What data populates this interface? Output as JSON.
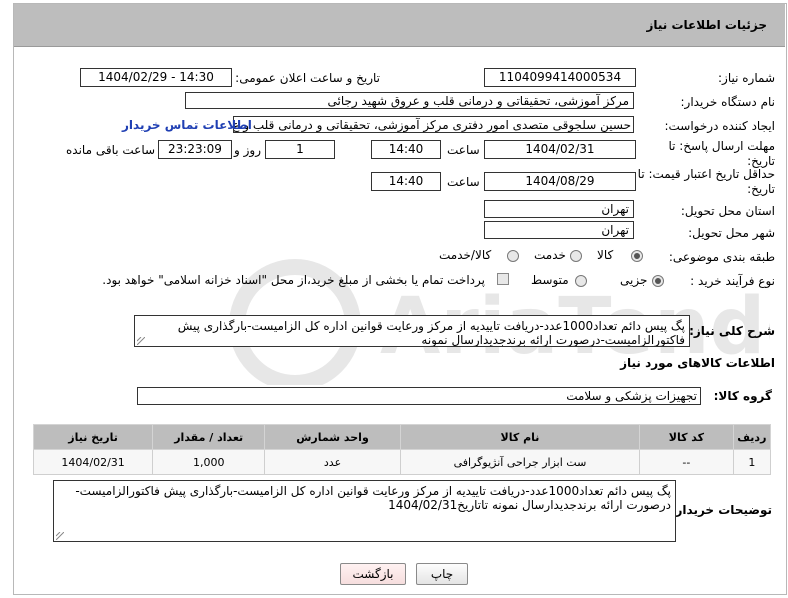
{
  "header": {
    "title": "جزئیات اطلاعات نیاز"
  },
  "fields": {
    "need_number_label": "شماره نیاز:",
    "need_number": "1104099414000534",
    "announce_label": "تاریخ و ساعت اعلان عمومی:",
    "announce_value": "1404/02/29 - 14:30",
    "buyer_org_label": "نام دستگاه خریدار:",
    "buyer_org": "مرکز آموزشی، تحقیقاتی و درمانی قلب و عروق شهید رجائی",
    "creator_label": "ایجاد کننده درخواست:",
    "creator": "حسین سلجوقی متصدی امور دفتری مرکز آموزشی، تحقیقاتی و درمانی قلب و ع",
    "contact_link": "اطلاعات تماس خریدار",
    "reply_deadline_label": "مهلت ارسال پاسخ: تا تاریخ:",
    "reply_date": "1404/02/31",
    "time_label": "ساعت",
    "reply_time": "14:40",
    "days_value": "1",
    "days_label": "روز و",
    "remaining_time": "23:23:09",
    "remaining_label": "ساعت باقی مانده",
    "min_price_label": "حداقل تاریخ اعتبار قیمت: تا تاریخ:",
    "min_price_date": "1404/08/29",
    "min_price_time": "14:40",
    "province_label": "استان محل تحویل:",
    "province": "تهران",
    "city_label": "شهر محل تحویل:",
    "city": "تهران",
    "category_label": "طبقه بندی موضوعی:",
    "category_options": [
      "کالا",
      "خدمت",
      "کالا/خدمت"
    ],
    "process_label": "نوع فرآیند خرید :",
    "process_options": [
      "جزیی",
      "متوسط"
    ],
    "payment_note": "پرداخت تمام یا بخشی از مبلغ خرید،از محل \"اسناد خزانه اسلامی\" خواهد بود."
  },
  "description": {
    "label": "شرح کلی نیاز:",
    "text": "پگ پیس دائم تعداد1000عدد-دریافت تاییدیه از مرکز ورعایت قوانین اداره کل الزامیست-بارگذاری پیش فاکتورالزامیست-درصورت ارائه برندجدیدارسال نمونه"
  },
  "goods_section": {
    "title": "اطلاعات کالاهای مورد نیاز",
    "group_label": "گروه کالا:",
    "group_value": "تجهیزات پزشکی و سلامت"
  },
  "table": {
    "headers": [
      "ردیف",
      "کد کالا",
      "نام کالا",
      "واحد شمارش",
      "تعداد / مقدار",
      "تاریخ نیاز"
    ],
    "rows": [
      [
        "1",
        "--",
        "ست ابزار جراحی آنژیوگرافی",
        "عدد",
        "1,000",
        "1404/02/31"
      ]
    ]
  },
  "buyer_notes": {
    "label": "توضیحات خریدار:",
    "text": "پگ پیس دائم تعداد1000عدد-دریافت تاییدیه از مرکز ورعایت قوانین اداره کل الزامیست-بارگذاری پیش فاکتورالزامیست-درصورت ارائه برندجدیدارسال نمونه تاتاریخ1404/02/31"
  },
  "buttons": {
    "print": "چاپ",
    "back": "بازگشت"
  },
  "watermark": "AriaTender.neT"
}
